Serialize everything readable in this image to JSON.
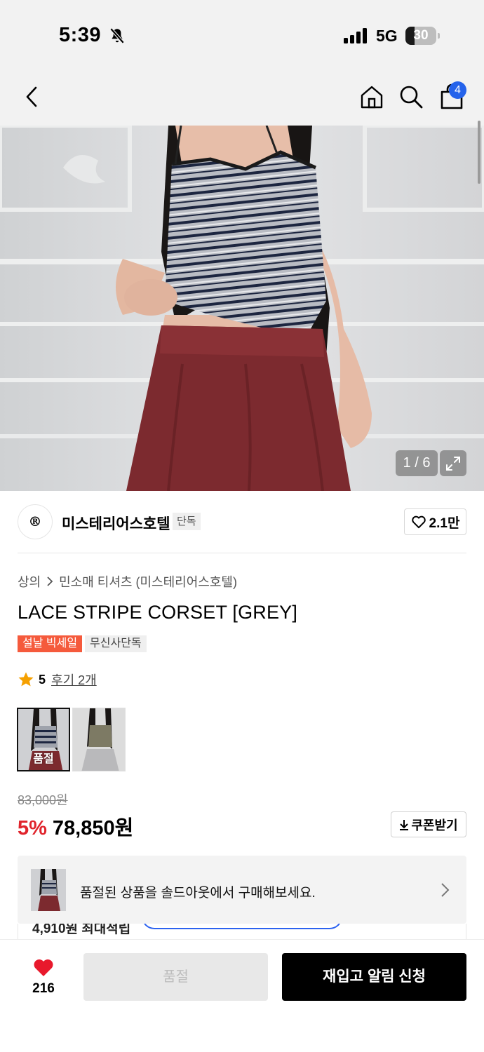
{
  "status_bar": {
    "time": "5:39",
    "network": "5G",
    "battery_level": "30",
    "battery_fraction": 0.3,
    "icons": [
      "bell-off-icon",
      "signal-icon",
      "battery-icon"
    ]
  },
  "nav": {
    "icons": [
      "back-icon",
      "home-icon",
      "search-icon",
      "shopping-bag-icon"
    ],
    "cart_count": "4"
  },
  "gallery": {
    "counter": "1 / 6",
    "expand_icon": "expand-icon"
  },
  "brand": {
    "logo_text": "®",
    "name": "미스테리어스호텔",
    "tag": "단독",
    "likes": "2.1만"
  },
  "product": {
    "breadcrumb": [
      "상의",
      "민소매 티셔츠 (미스테리어스호텔)"
    ],
    "title": "LACE STRIPE CORSET [GREY]",
    "badges": [
      "설날 빅세일",
      "무신사단독"
    ],
    "rating": "5",
    "reviews": "후기 2개",
    "thumbnail_soldout": "품절",
    "original_price": "83,000원",
    "discount": "5%",
    "price": "78,850원",
    "coupon_label": "쿠폰받기"
  },
  "banner": {
    "text": "품절된 상품을 솔드아웃에서 구매해보세요.",
    "peek_text": "4,910원 최대적립"
  },
  "colors": {
    "accent_blue": "#2563eb",
    "sale_red": "#e0242c",
    "badge_orange": "#f55a3c",
    "heart_red": "#e8192c"
  },
  "bottom_bar": {
    "wish_count": "216",
    "soldout_label": "품절",
    "restock_label": "재입고 알림 신청"
  }
}
